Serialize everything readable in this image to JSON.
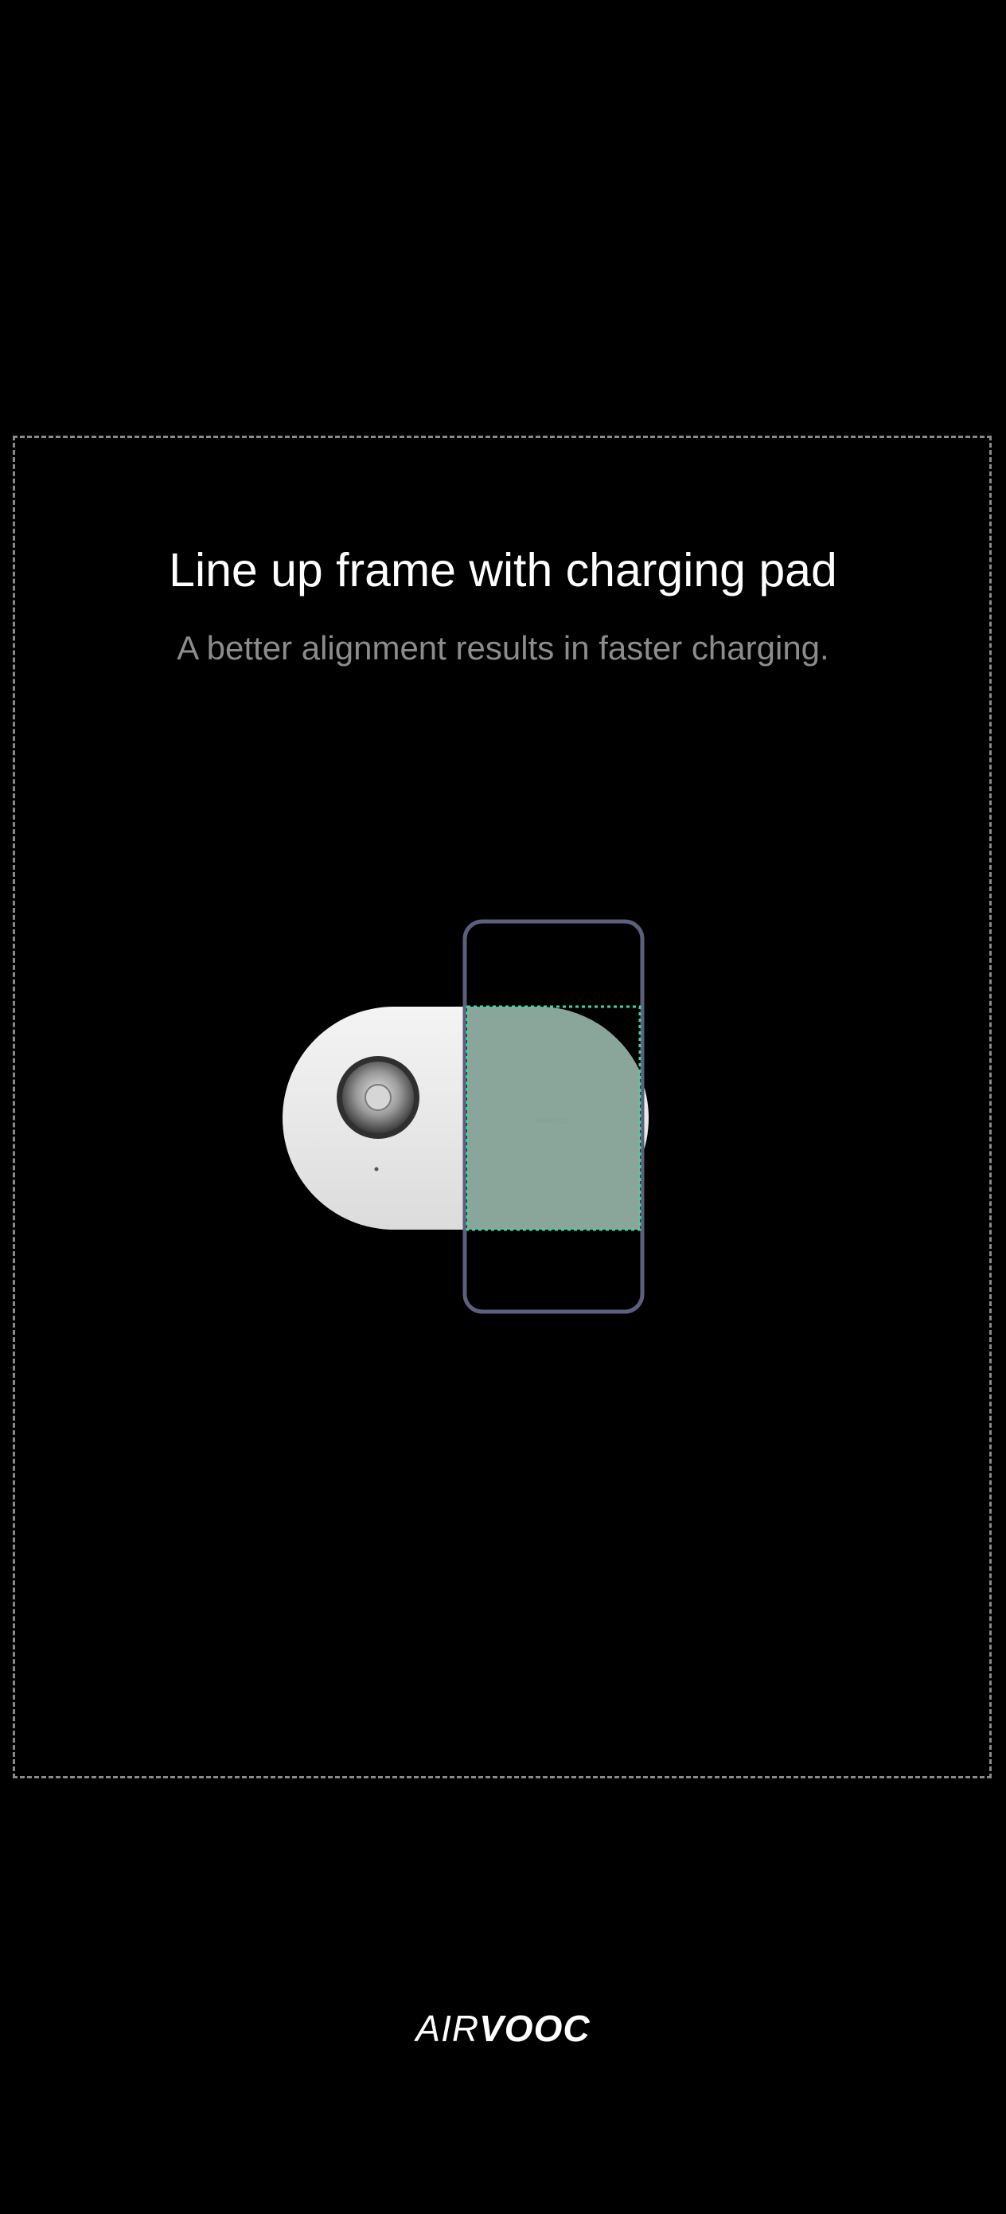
{
  "guide": {
    "title": "Line up frame with charging pad",
    "subtitle": "A better alignment results in faster charging."
  },
  "illustration": {
    "charger_logo": "AIRVOOC",
    "alignment_color": "#3cd6a0",
    "phone_frame_color": "#5c5f7e"
  },
  "brand": {
    "air": "AIR",
    "vooc": "VOOC"
  },
  "colors": {
    "background": "#000000",
    "frame_border": "#8a8a8a",
    "title": "#ffffff",
    "subtitle": "#8c8c8c"
  }
}
